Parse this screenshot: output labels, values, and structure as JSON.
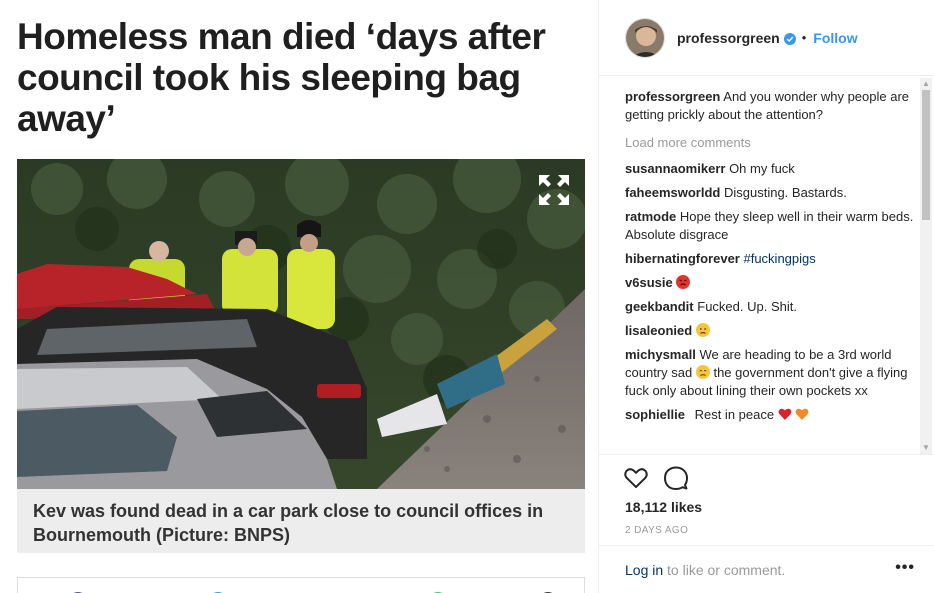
{
  "article": {
    "headline": "Homeless man died ‘days after council took his sleeping bag away’",
    "caption": "Kev was found dead in a car park close to council offices in Bournemouth (Picture: BNPS)",
    "icons": {
      "expand": "expand-icon"
    }
  },
  "post": {
    "username": "professorgreen",
    "separator": "•",
    "follow_label": "Follow",
    "caption": {
      "user": "professorgreen",
      "text": "And you wonder why people are getting prickly about the attention?"
    },
    "load_more": "Load more comments",
    "comments": [
      {
        "user": "susannaomikerr",
        "text": "Oh my fuck"
      },
      {
        "user": "faheemsworldd",
        "text": "Disgusting. Bastards."
      },
      {
        "user": "ratmode",
        "text": "Hope they sleep well in their warm beds. Absolute disgrace"
      },
      {
        "user": "hibernatingforever",
        "text": "",
        "tag": "#fuckingpigs"
      },
      {
        "user": "v6susie",
        "text": ""
      },
      {
        "user": "geekbandit",
        "text": "Fucked. Up. Shit."
      },
      {
        "user": "lisaleonied",
        "text": ""
      },
      {
        "user": "michysmall",
        "text_before": "We are heading to be a 3rd world country sad",
        "text_after": "the government don't give a flying fuck only about lining their own pockets xx"
      },
      {
        "user": "sophiellie",
        "text": "Rest in peace"
      }
    ],
    "likes": "18,112 likes",
    "date": "2 DAYS AGO",
    "login_link": "Log in",
    "login_rest": " to like or comment.",
    "more_label": "•••",
    "icons": {
      "like": "heart-icon",
      "comment": "comment-icon",
      "verified": "verified-badge-icon"
    },
    "colors": {
      "link": "#3897f0",
      "text": "#262626",
      "muted": "#999999"
    }
  }
}
